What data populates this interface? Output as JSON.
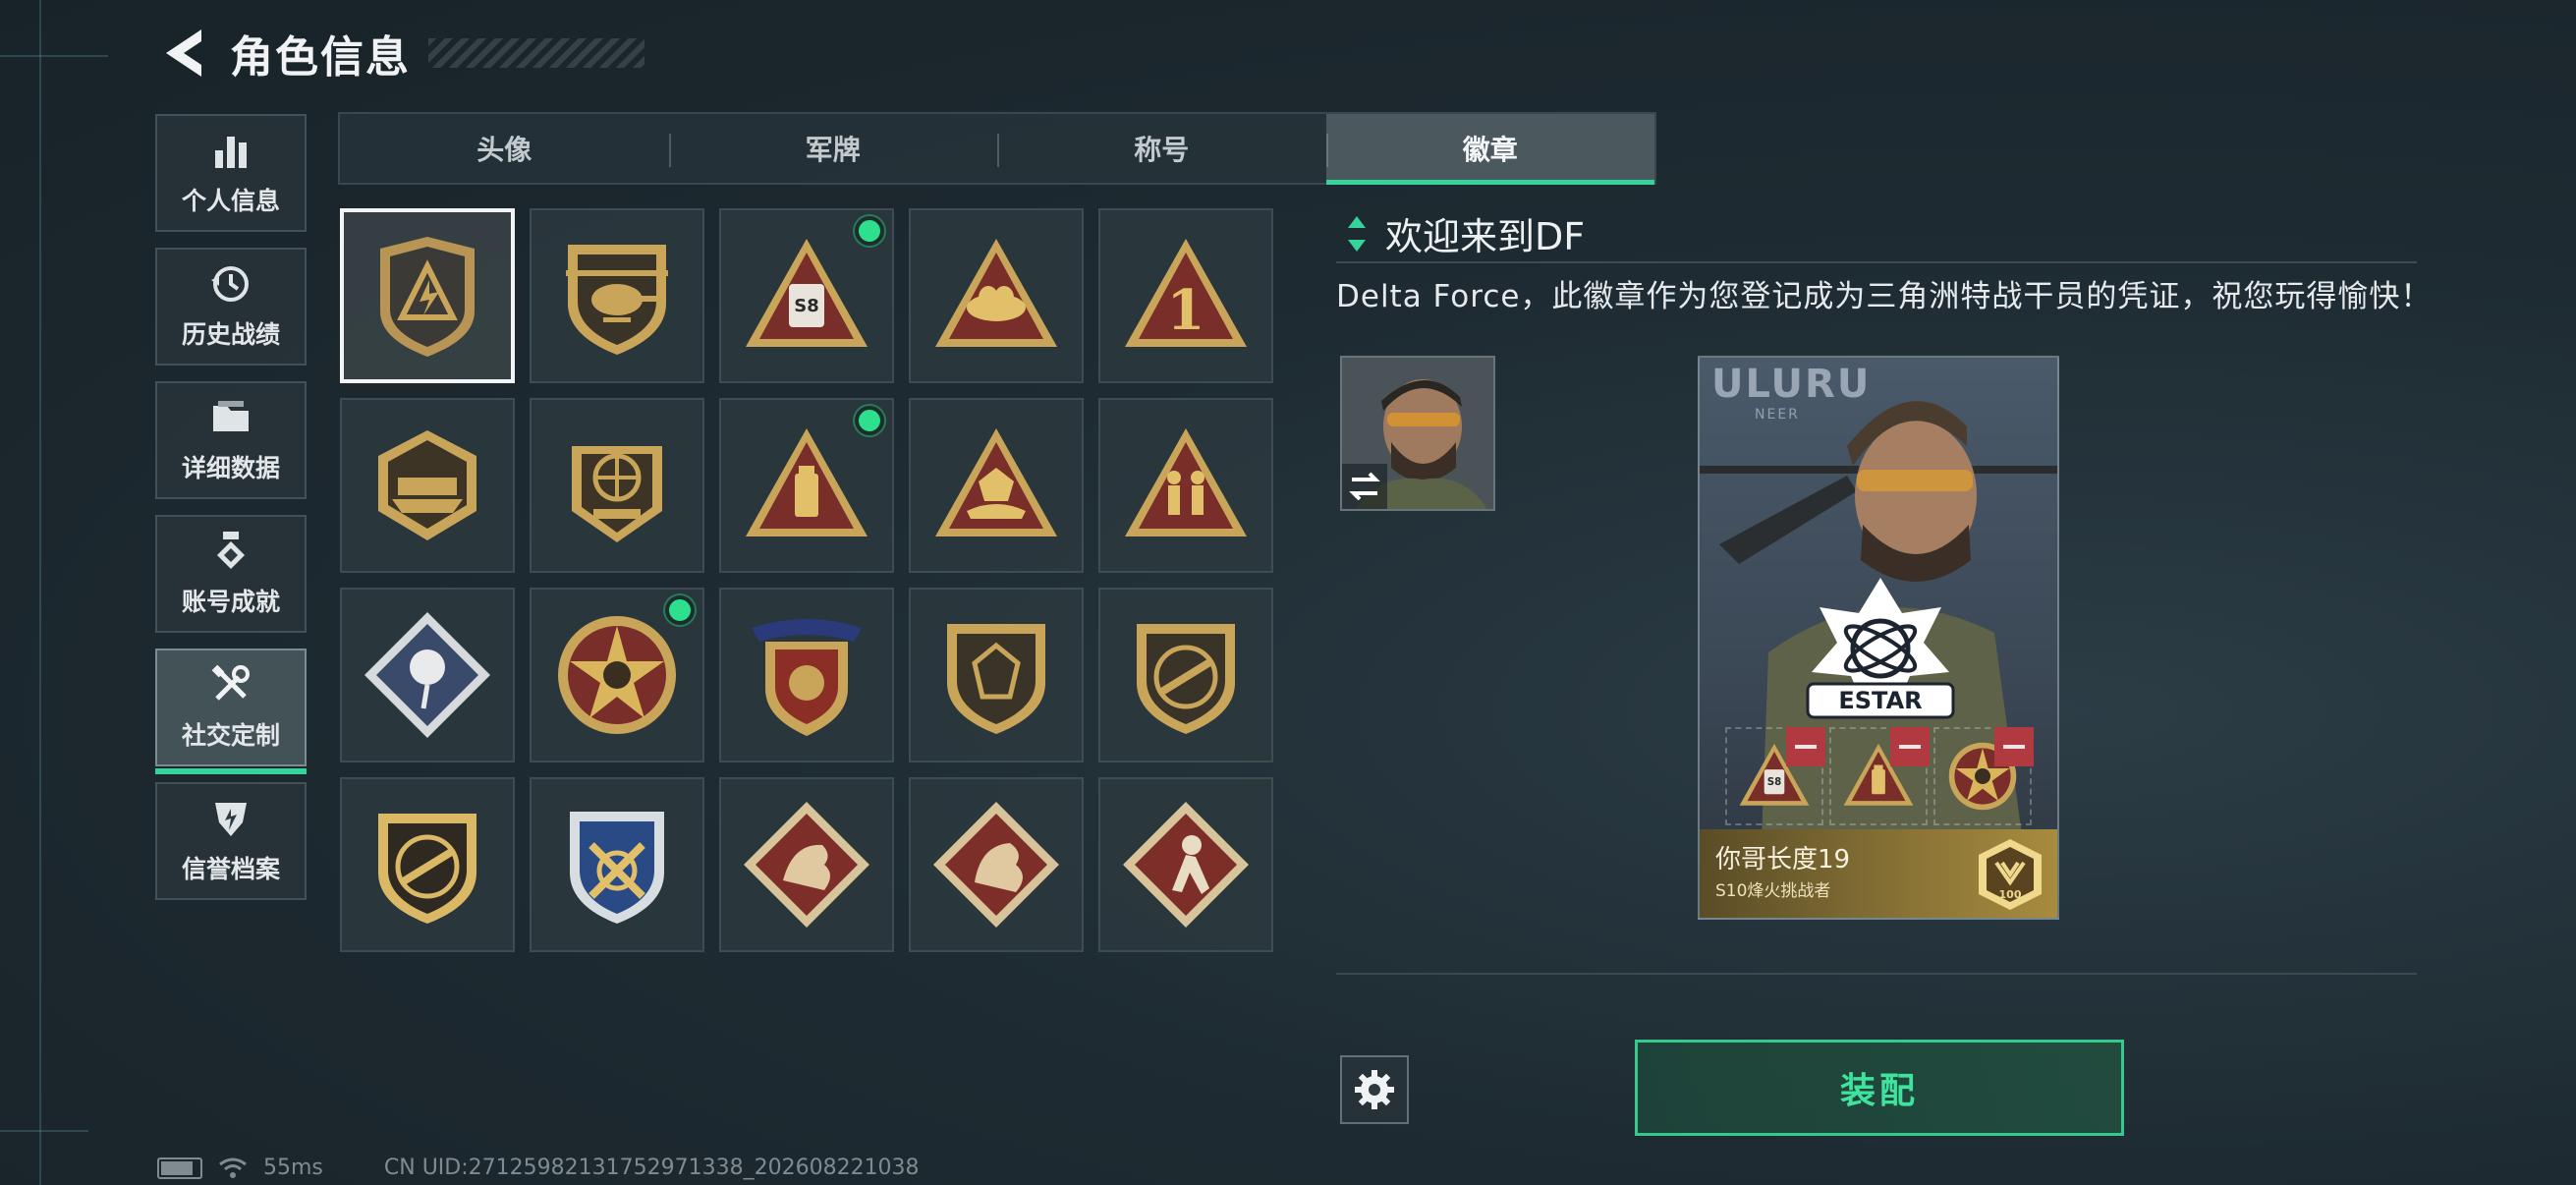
{
  "header": {
    "title": "角色信息"
  },
  "sidebar": {
    "items": [
      {
        "label": "个人信息",
        "icon": "bar-chart-icon"
      },
      {
        "label": "历史战绩",
        "icon": "history-icon"
      },
      {
        "label": "详细数据",
        "icon": "folder-icon"
      },
      {
        "label": "账号成就",
        "icon": "achievement-icon"
      },
      {
        "label": "社交定制",
        "icon": "tools-icon",
        "active": true
      },
      {
        "label": "信誉档案",
        "icon": "credit-shield-icon"
      }
    ]
  },
  "tabs": [
    {
      "label": "头像"
    },
    {
      "label": "军牌"
    },
    {
      "label": "称号"
    },
    {
      "label": "徽章",
      "active": true
    }
  ],
  "badges": {
    "selected_index": 0,
    "new_indices": [
      2,
      7,
      11
    ],
    "items": [
      "shield-lightning-badge",
      "helicopter-badge",
      "s8-triangle-badge",
      "nest-triangle-badge",
      "number-one-triangle-badge",
      "2026-delta-force-badge",
      "delta-force-globe-2026-badge",
      "usb-triangle-badge",
      "crystal-hands-triangle-badge",
      "soldiers-triangle-badge",
      "rose-diamond-badge",
      "star-compass-badge",
      "stars-shield-badge",
      "gem-shield-badge",
      "rifle-shield-badge",
      "rifle-shield-gold-badge",
      "crossed-swords-shield-badge",
      "dragon-diamond-badge",
      "dragon-diamond-red-badge",
      "beast-diamond-badge"
    ]
  },
  "detail": {
    "title": "欢迎来到DF",
    "description": "Delta Force，此徽章作为您登记成为三角洲特战干员的凭证，祝您玩得愉快！"
  },
  "card": {
    "brand": "ULURU",
    "brand_sub": "NEER",
    "team_logo": "ESTAR",
    "player_name": "你哥长度19",
    "rank_title": "S10烽火挑战者",
    "rank_number": "100",
    "equipped_slots": [
      "s8-triangle-badge",
      "usb-triangle-badge",
      "star-compass-badge"
    ]
  },
  "actions": {
    "equip_label": "装配"
  },
  "status": {
    "ping": "55ms",
    "uid": "CN UID:27125982131752971338_202608221038"
  },
  "colors": {
    "accent": "#35d49a",
    "new_dot": "#2ee08e",
    "badge_gold": "#c9a55a",
    "badge_red": "#7a2e2a",
    "remove": "#b03a40"
  }
}
